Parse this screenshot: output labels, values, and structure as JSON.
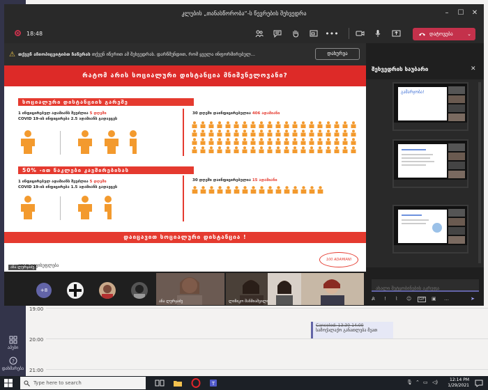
{
  "window": {
    "title": "კლუბის „თანასწორობა“-ს წევრების შეხვედრა",
    "minimize": "–",
    "maximize": "☐",
    "close": "✕"
  },
  "toolbar": {
    "timer": "18:48",
    "leave_label": "დატოვება"
  },
  "notice": {
    "bold": "თქვენ აჩიოპიცეიტიბთ ჩაწერას",
    "text": "თქვენ იწერით ამ შეხვედრას. დარწმუნდით, რომ ყველა ინფორმირებულ...",
    "dismiss_label": "დახურვა"
  },
  "slide": {
    "header": "რატომ არის სოციალური დისტანცია მნიშვნელოვანი?",
    "sec1_title": "სოციალური დისტანციის გარეშე",
    "sec1_line1": "1 ინფიცირებულ ადამიანს შეუძლია",
    "sec1_line1_hl": "5 დღეში",
    "sec1_line2": "COVID 19-ის ინფიცირება 2.5 ადამიანს გადაეცეს",
    "sec1_right_a": "30 დღეში დაინფიცირებულია",
    "sec1_right_b": "406 ადამიანი",
    "sec2_title": "50% -ით ნაკლები კავშირებისას",
    "sec2_line1": "1 ინფიცირებულ ადამიანს შეუძლია",
    "sec2_line1_hl": "5 დღეში",
    "sec2_line2": "COVID 19-ის ინფიცირება 1.5 ადამიანს გადაეცეს",
    "sec2_right_a": "30 დღეში დაინფიცირებულია",
    "sec2_right_b": "15 ადამიანი",
    "footer": "დაიცავით სოციალური დისტანცია !",
    "bottom_text": "...ადით თავისუფლება",
    "logo": "100 ADAMIANI",
    "presenter": "ანა ლურჯაძე"
  },
  "participants": {
    "overflow": "+8",
    "tiles": [
      {
        "name": "ანა ლურჯაძე"
      },
      {
        "name": "ლიზიკო შანშიაშვილი"
      },
      {
        "name": ""
      },
      {
        "name": ""
      }
    ]
  },
  "chat": {
    "title": "შეხვედრის საუბარი",
    "placeholder": "ახალი შეტყობინების აკრეფა",
    "thumb1_text": "გამარჯობა!"
  },
  "calendar": {
    "times": [
      "19:00",
      "20:00",
      "21:00"
    ],
    "event_line1": "Canceled: 13:30-14:00",
    "event_line2": "სამოქალაქო განათლება მეათ"
  },
  "rail": {
    "item1": "აპები",
    "item2": "დახმარება"
  },
  "taskbar": {
    "search_placeholder": "Type here to search",
    "time": "12:14 PM",
    "date": "1/29/2021"
  },
  "colors": {
    "accent": "#6264a7",
    "leave": "#c4314b",
    "slide_red": "#e53a2f",
    "people_orange": "#f39a2e"
  }
}
